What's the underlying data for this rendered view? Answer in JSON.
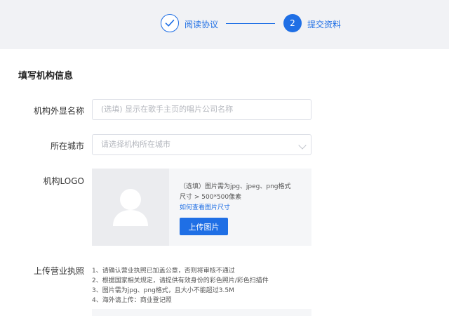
{
  "steps": [
    {
      "label": "阅读协议",
      "state": "done",
      "icon": "check-icon"
    },
    {
      "label": "提交资料",
      "number": "2",
      "state": "active"
    }
  ],
  "section_title": "填写机构信息",
  "form": {
    "name": {
      "label": "机构外显名称",
      "placeholder": "(选填) 显示在歌手主页的唱片公司名称"
    },
    "city": {
      "label": "所在城市",
      "placeholder": "请选择机构所在城市"
    },
    "logo": {
      "label": "机构LOGO",
      "hint1": "（选填）图片需为jpg、jpeg、png格式",
      "hint2": "尺寸 > 500*500像素",
      "link": "如何查看图片尺寸",
      "button": "上传图片"
    },
    "license": {
      "label": "上传营业执照",
      "notes": [
        "1、请确认营业执照已加盖公章，否则将审核不通过",
        "2、根据国家相关规定，请提供有效身份的彩色照片/彩色扫描件",
        "3、图片需为jpg、png格式，且大小不能超过3.5M",
        "4、海外请上传：商业登记照"
      ]
    }
  },
  "colors": {
    "accent": "#1f6fe5",
    "header_bg": "#f1f2f5",
    "placeholder_bg": "#f5f6f8"
  }
}
